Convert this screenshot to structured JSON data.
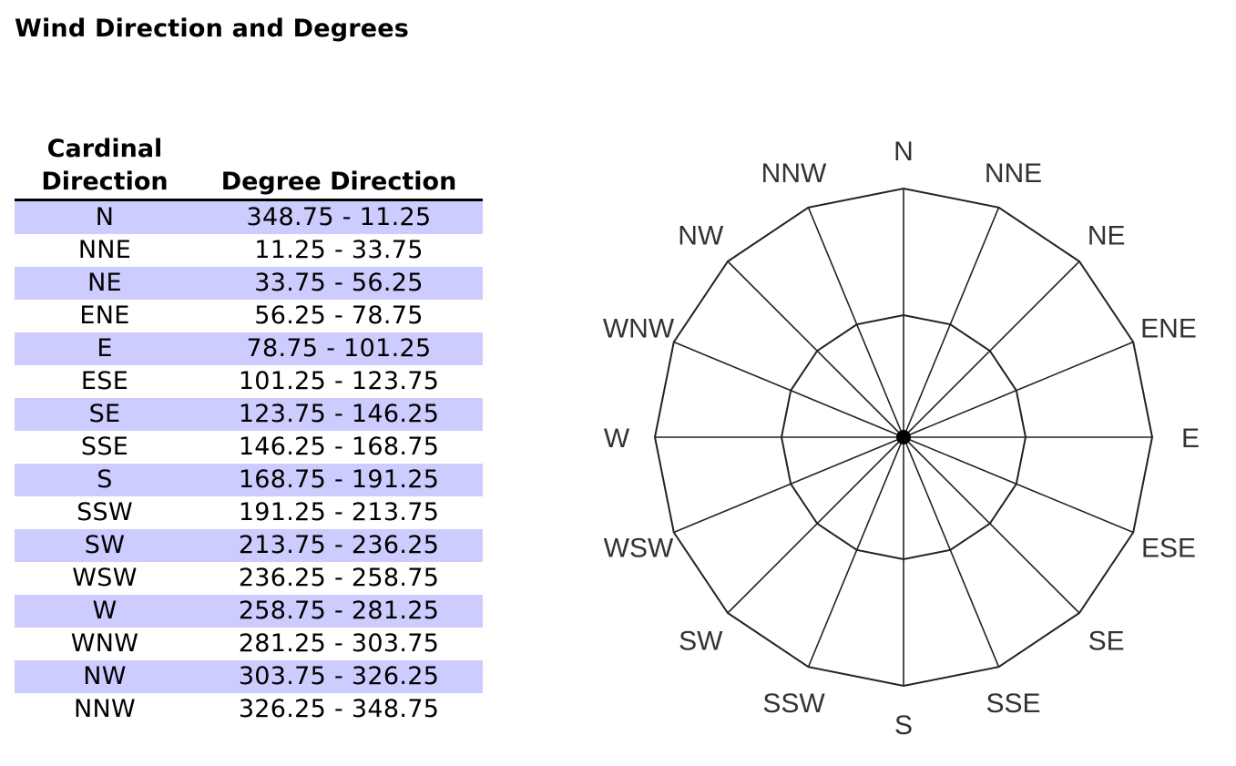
{
  "title": "Wind Direction and Degrees",
  "table": {
    "headers": [
      "Cardinal Direction",
      "Degree Direction"
    ],
    "rows": [
      {
        "cardinal": "N",
        "degrees": "348.75 - 11.25"
      },
      {
        "cardinal": "NNE",
        "degrees": "11.25 - 33.75"
      },
      {
        "cardinal": "NE",
        "degrees": "33.75 - 56.25"
      },
      {
        "cardinal": "ENE",
        "degrees": "56.25 - 78.75"
      },
      {
        "cardinal": "E",
        "degrees": "78.75 - 101.25"
      },
      {
        "cardinal": "ESE",
        "degrees": "101.25 - 123.75"
      },
      {
        "cardinal": "SE",
        "degrees": "123.75 - 146.25"
      },
      {
        "cardinal": "SSE",
        "degrees": "146.25 - 168.75"
      },
      {
        "cardinal": "S",
        "degrees": "168.75 - 191.25"
      },
      {
        "cardinal": "SSW",
        "degrees": "191.25 - 213.75"
      },
      {
        "cardinal": "SW",
        "degrees": "213.75 - 236.25"
      },
      {
        "cardinal": "WSW",
        "degrees": "236.25 - 258.75"
      },
      {
        "cardinal": "W",
        "degrees": "258.75 - 281.25"
      },
      {
        "cardinal": "WNW",
        "degrees": "281.25 - 303.75"
      },
      {
        "cardinal": "NW",
        "degrees": "303.75 - 326.25"
      },
      {
        "cardinal": "NNW",
        "degrees": "326.25 - 348.75"
      }
    ],
    "shade_color": "#ccccff"
  },
  "compass_rose": {
    "labels": [
      "N",
      "NNE",
      "NE",
      "ENE",
      "E",
      "ESE",
      "SE",
      "SSE",
      "S",
      "SSW",
      "SW",
      "WSW",
      "W",
      "WNW",
      "NW",
      "NNW"
    ],
    "line_color": "#222222",
    "label_color": "#333333"
  }
}
